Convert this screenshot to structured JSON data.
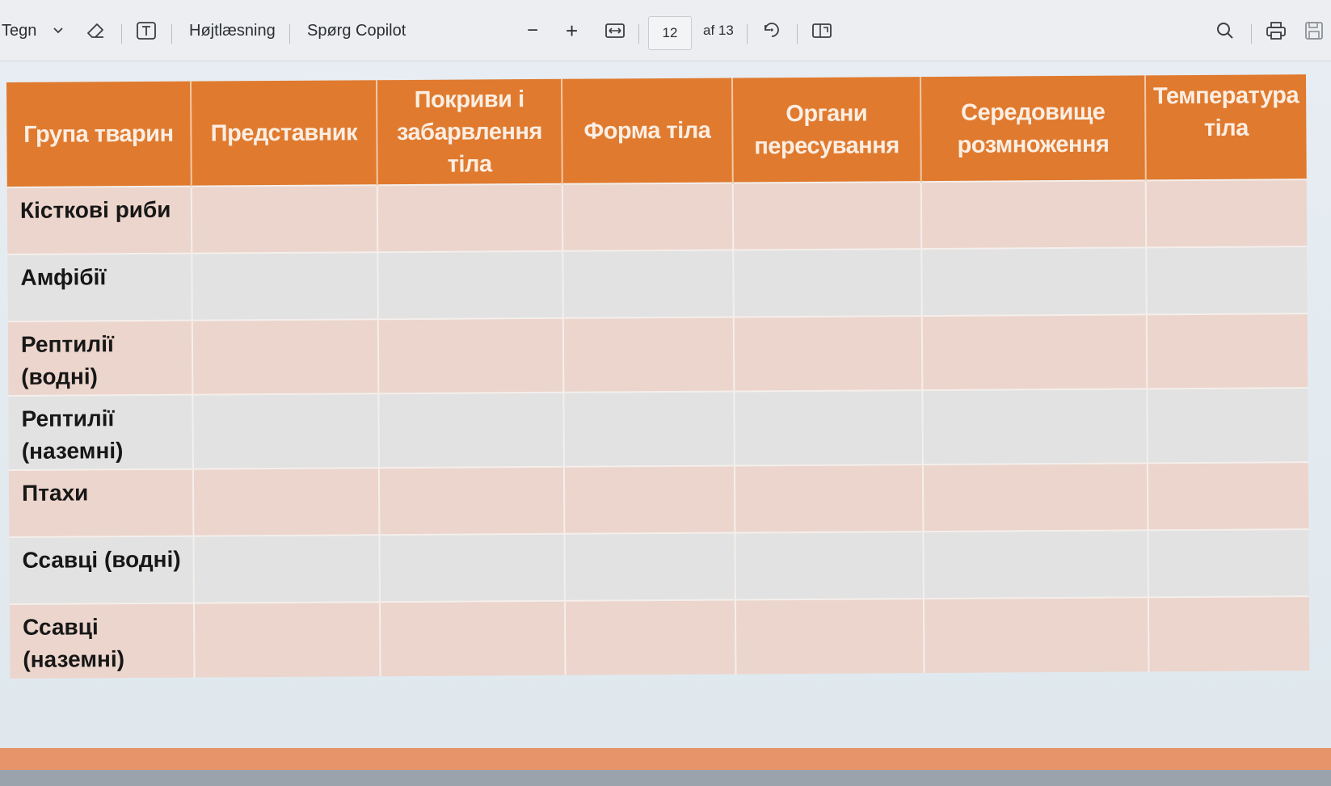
{
  "toolbar": {
    "draw_label": "Tegn",
    "read_aloud_label": "Højtlæsning",
    "copilot_label": "Spørg Copilot",
    "zoom_out": "−",
    "zoom_in": "+",
    "page_current": "12",
    "page_total": "af 13"
  },
  "table": {
    "headers": [
      "Група тварин",
      "Представник",
      "Покриви і забарвлення тіла",
      "Форма тіла",
      "Органи пересування",
      "Середовище розмноження",
      "Температура тіла"
    ],
    "rows": [
      "Кісткові риби",
      "Амфібії",
      "Рептилії\n(водні)",
      "Рептилії\n(наземні)",
      "Птахи",
      "Ссавці (водні)",
      "Ссавці\n(наземні)"
    ]
  },
  "colors": {
    "header_orange": "#e07a2e",
    "row_peach": "#ecd5cc",
    "row_gray": "#e2e2e2"
  }
}
